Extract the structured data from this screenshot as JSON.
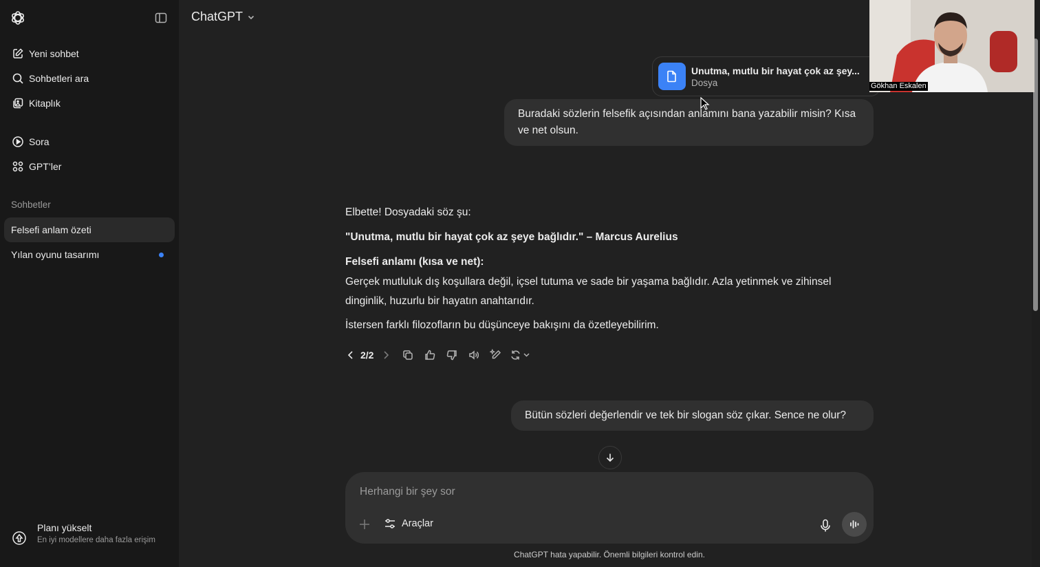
{
  "sidebar": {
    "toggle_icon": "sidebar-toggle-icon",
    "nav": [
      {
        "label": "Yeni sohbet",
        "icon": "new-chat-icon"
      },
      {
        "label": "Sohbetleri ara",
        "icon": "search-icon"
      },
      {
        "label": "Kitaplık",
        "icon": "library-icon"
      },
      {
        "label": "Sora",
        "icon": "play-icon"
      },
      {
        "label": "GPT’ler",
        "icon": "grid-icon"
      }
    ],
    "section_label": "Sohbetler",
    "chats": [
      {
        "label": "Felsefi anlam özeti",
        "active": true
      },
      {
        "label": "Yılan oyunu tasarımı",
        "unread": true
      }
    ],
    "upgrade": {
      "title": "Planı yükselt",
      "subtitle": "En iyi modellere daha fazla erişim"
    }
  },
  "header": {
    "model": "ChatGPT"
  },
  "conversation": {
    "file": {
      "name": "Unutma, mutlu bir hayat çok az şey...",
      "type": "Dosya"
    },
    "user_message_1": "Buradaki sözlerin felsefik açısından anlamını bana yazabilir misin? Kısa ve net olsun.",
    "assistant": {
      "intro": "Elbette! Dosyadaki söz şu:",
      "quote": "\"Unutma, mutlu bir hayat çok az şeye bağlıdır.\" – Marcus Aurelius",
      "heading": "Felsefi anlamı (kısa ve net):",
      "body": "Gerçek mutluluk dış koşullara değil, içsel tutuma ve sade bir yaşama bağlıdır. Azla yetinmek ve zihinsel dinginlik, huzurlu bir hayatın anahtarıdır.",
      "outro": "İstersen farklı filozofların bu düşünceye bakışını da özetleyebilirim.",
      "pager": "2/2"
    },
    "user_message_2": "Bütün sözleri değerlendir ve tek bir slogan söz çıkar. Sence ne olur?"
  },
  "composer": {
    "placeholder": "Herhangi bir şey sor",
    "tools_label": "Araçlar",
    "disclaimer": "ChatGPT hata yapabilir. Önemli bilgileri kontrol edin."
  },
  "webcam": {
    "name": "Gökhan Eskalen"
  },
  "colors": {
    "background": "#212121",
    "sidebar": "#181818",
    "bubble": "#303030",
    "accent": "#3b82f6"
  }
}
